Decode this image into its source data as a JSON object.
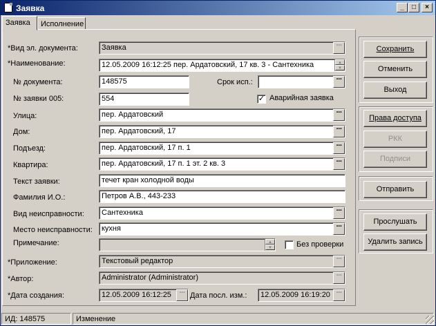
{
  "window": {
    "title": "Заявка"
  },
  "tabs": [
    {
      "label": "Заявка"
    },
    {
      "label": "Исполнение"
    }
  ],
  "form": {
    "doc_kind_label": "*Вид эл. документа:",
    "doc_kind_value": "Заявка",
    "name_label": "*Наименование:",
    "name_value": "12.05.2009 16:12:25 пер. Ардатовский, 17 кв. 3 - Сантехника",
    "doc_number_label": "№ документа:",
    "doc_number_value": "148575",
    "deadline_label": "Срок исп.:",
    "deadline_value": "",
    "request_number_label": "№ заявки 005:",
    "request_number_value": "554",
    "emergency_label": "Аварийная заявка",
    "emergency_checked": "✓",
    "street_label": "Улица:",
    "street_value": "пер. Ардатовский",
    "house_label": "Дом:",
    "house_value": "пер. Ардатовский, 17",
    "entrance_label": "Подъезд:",
    "entrance_value": "пер. Ардатовский, 17 п. 1",
    "apartment_label": "Квартира:",
    "apartment_value": "пер. Ардатовский, 17 п. 1 эт. 2 кв. 3",
    "request_text_label": "Текст заявки:",
    "request_text_value": "течет кран холодной воды",
    "fio_label": "Фамилия И.О.:",
    "fio_value": "Петров А.В., 443-233",
    "fault_kind_label": "Вид неисправности:",
    "fault_kind_value": "Сантехника",
    "fault_place_label": "Место неисправности:",
    "fault_place_value": "кухня",
    "note_label": "Примечание:",
    "note_value": "",
    "no_check_label": "Без проверки",
    "attachment_label": "*Приложение:",
    "attachment_value": "Текстовый редактор",
    "author_label": "*Автор:",
    "author_value": "Administrator (Administrator)",
    "created_label": "*Дата создания:",
    "created_value": "12.05.2009 16:12:25",
    "modified_label": "Дата посл. изм.:",
    "modified_value": "12.05.2009 16:19:20",
    "dots": "···"
  },
  "buttons": {
    "save": "Сохранить",
    "cancel": "Отменить",
    "exit": "Выход",
    "access_rights": "Права доступа",
    "rkk": "РКК",
    "signatures": "Подписи",
    "send": "Отправить",
    "listen": "Прослушать",
    "delete_record": "Удалить запись"
  },
  "status": {
    "id": "ИД: 148575",
    "state": "Изменение"
  }
}
